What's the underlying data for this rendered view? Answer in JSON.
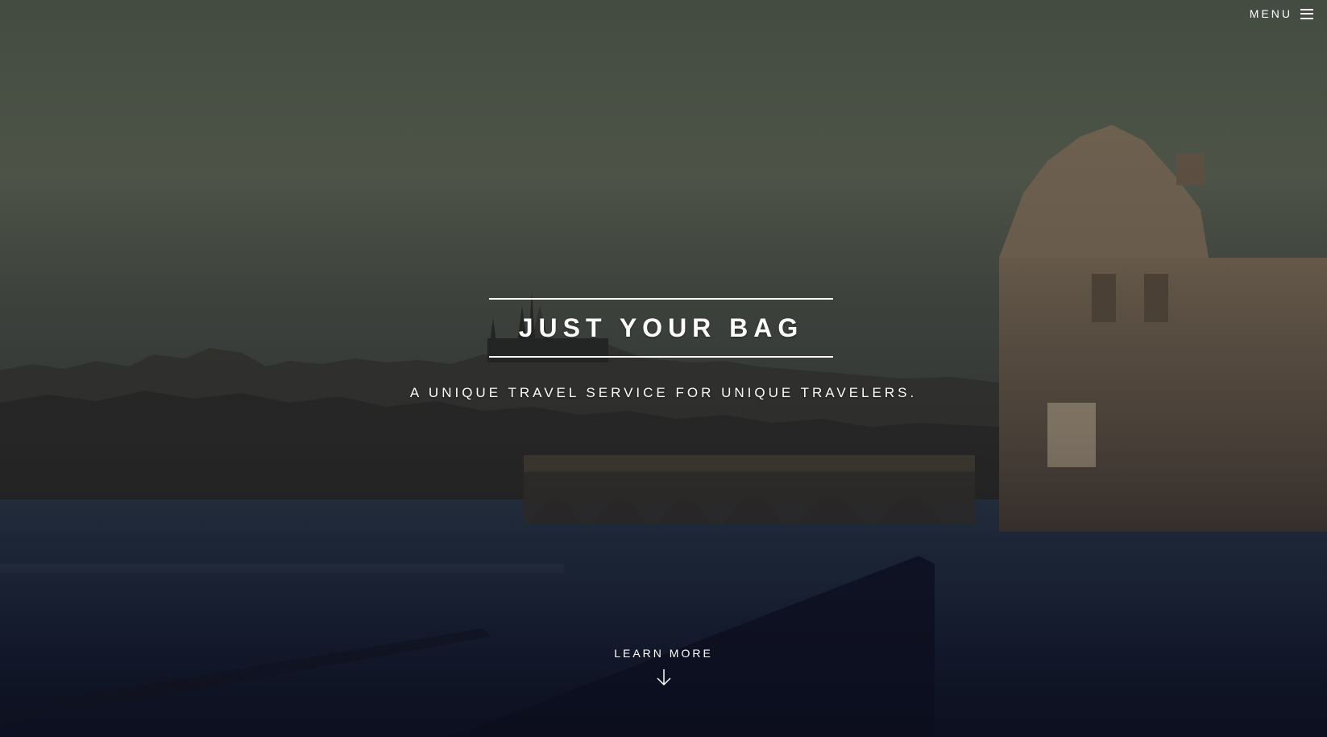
{
  "header": {
    "menu_label": "MENU",
    "menu_icon": "hamburger-icon"
  },
  "hero": {
    "title": "JUST YOUR BAG",
    "subtitle": "A UNIQUE TRAVEL SERVICE FOR UNIQUE TRAVELERS.",
    "learn_more_label": "LEARN MORE",
    "learn_more_icon": "arrow-down-icon",
    "background_image": "prague-charles-bridge-photo"
  },
  "colors": {
    "text": "#ffffff",
    "sky": "#59624d",
    "water": "#1c2638"
  }
}
